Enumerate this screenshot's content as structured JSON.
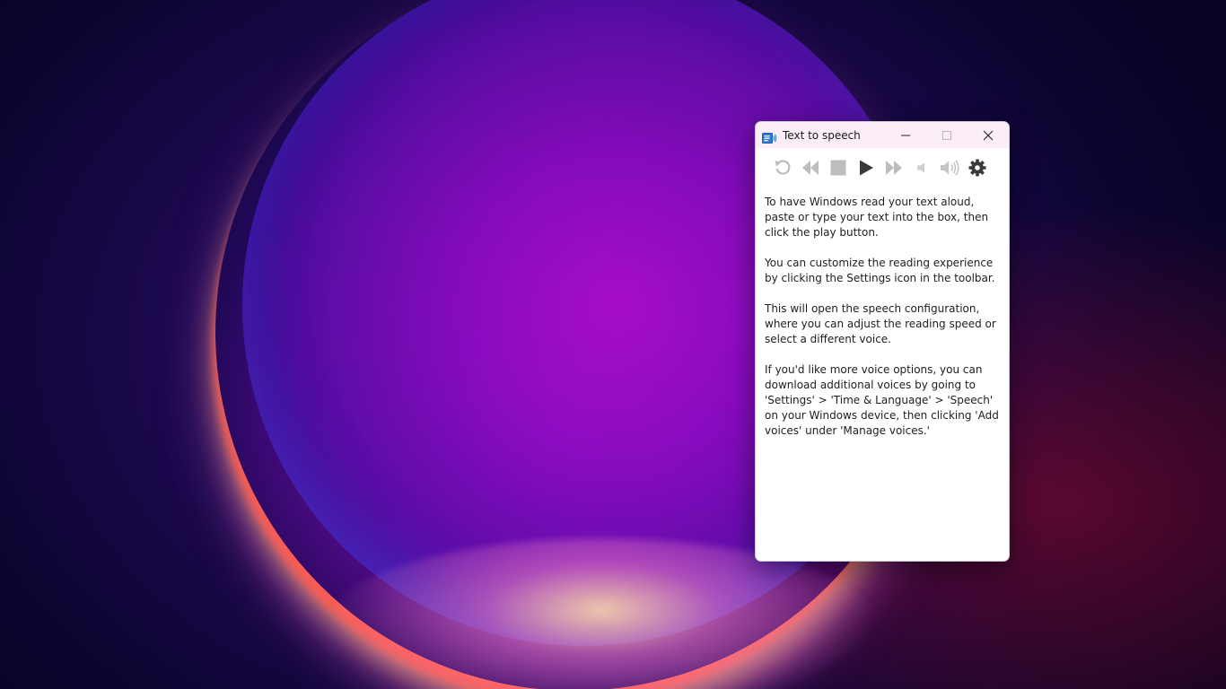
{
  "window": {
    "title": "Text to speech"
  },
  "icons": {
    "app": "speaker-window-icon",
    "minimize": "minimize-icon",
    "maximize": "maximize-icon",
    "close": "close-icon",
    "replay": "replay-icon",
    "rewind": "rewind-icon",
    "stop": "stop-icon",
    "play": "play-icon",
    "fast_forward": "fast-forward-icon",
    "volume_down": "volume-down-icon",
    "volume_up": "volume-up-icon",
    "settings": "gear-icon"
  },
  "content": {
    "paragraphs": [
      "To have Windows read your text aloud, paste or type your text into the box, then click the play button.",
      "You can customize the reading experience by clicking the Settings icon in the toolbar.",
      "This will open the speech configuration, where you can adjust the reading speed or select a different voice.",
      "If you'd like more voice options, you can download additional voices by going to 'Settings' > 'Time & Language' > 'Speech' on your Windows device, then clicking 'Add voices' under 'Manage voices.'"
    ]
  },
  "colors": {
    "titlebar": "#fbeef6",
    "icon_disabled": "#bdbdbd",
    "icon_active": "#3a3a3a",
    "app_icon_blue": "#2e7fd6"
  }
}
